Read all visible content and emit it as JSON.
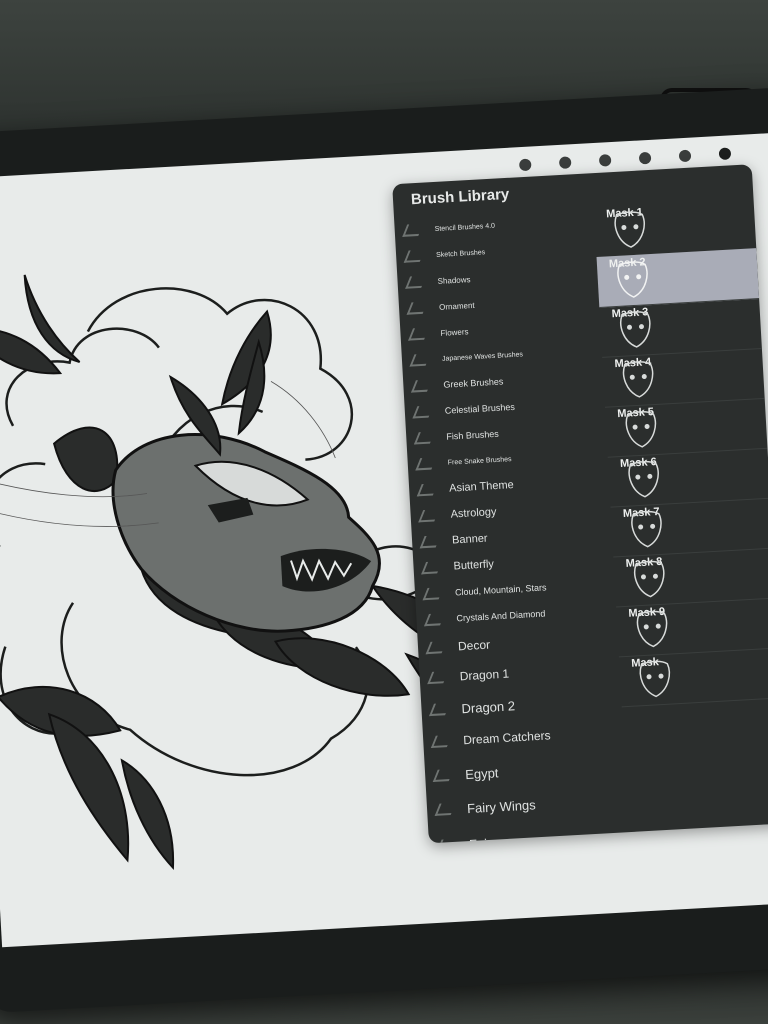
{
  "brush_library": {
    "title": "Brush Library",
    "categories": [
      {
        "label": "Stencil Brushes 4.0"
      },
      {
        "label": "Sketch Brushes"
      },
      {
        "label": "Shadows"
      },
      {
        "label": "Ornament"
      },
      {
        "label": "Flowers"
      },
      {
        "label": "Japanese Waves Brushes"
      },
      {
        "label": "Greek Brushes"
      },
      {
        "label": "Celestial Brushes"
      },
      {
        "label": "Fish Brushes"
      },
      {
        "label": "Free Snake Brushes"
      },
      {
        "label": "Asian Theme"
      },
      {
        "label": "Astrology"
      },
      {
        "label": "Banner"
      },
      {
        "label": "Butterfly"
      },
      {
        "label": "Cloud, Mountain, Stars"
      },
      {
        "label": "Crystals And Diamond"
      },
      {
        "label": "Decor"
      },
      {
        "label": "Dragon 1"
      },
      {
        "label": "Dragon 2"
      },
      {
        "label": "Dream Catchers"
      },
      {
        "label": "Egypt"
      },
      {
        "label": "Fairy Wings"
      },
      {
        "label": "Fairy"
      }
    ],
    "brushes": [
      {
        "name": "Mask 1",
        "selected": false
      },
      {
        "name": "Mask 2",
        "selected": true
      },
      {
        "name": "Mask 3",
        "selected": false
      },
      {
        "name": "Mask 4",
        "selected": false
      },
      {
        "name": "Mask 5",
        "selected": false
      },
      {
        "name": "Mask 6",
        "selected": false
      },
      {
        "name": "Mask 7",
        "selected": false
      },
      {
        "name": "Mask 8",
        "selected": false
      },
      {
        "name": "Mask 9",
        "selected": false
      },
      {
        "name": "Mask",
        "selected": false
      }
    ]
  },
  "colors": {
    "panel_bg": "#2b2e2d",
    "selected_row": "#a9acb7",
    "canvas_bg": "#e8ebea",
    "ink": "#1c1e1d"
  }
}
